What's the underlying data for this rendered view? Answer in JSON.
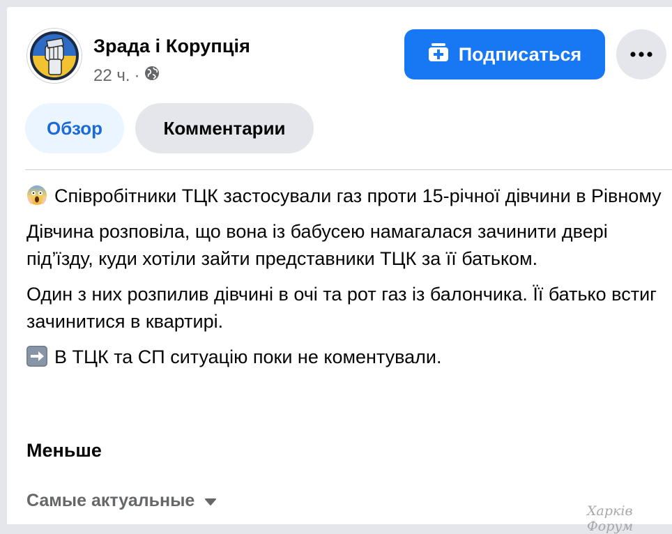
{
  "post": {
    "page_name": "Зрада і Корупція",
    "time": "22 ч.",
    "separator": "·",
    "subscribe_label": "Подписаться",
    "tabs": [
      {
        "label": "Обзор",
        "active": true
      },
      {
        "label": "Комментарии",
        "active": false
      }
    ],
    "paragraphs": [
      "Співробітники ТЦК застосували газ проти 15-річної дівчини в Рівному",
      "Дівчина розповіла, що вона із бабусею намагалася зачинити двері під’їзду, куди хотіли зайти представники ТЦК за її батьком.",
      "Один з них розпилив дівчині в очі та рот газ із балончика. Її батько встиг зачинитися в квартирі.",
      "В ТЦК та СП ситуацію поки не коментували."
    ],
    "less_label": "Меньше",
    "sort_label": "Самые актуальные"
  },
  "watermark": "Харків Форум",
  "icons": {
    "avatar": "fist-avatar-icon",
    "visibility": "globe-icon",
    "subscribe": "add-to-feed-icon",
    "more": "more-dots-icon",
    "first_paragraph": "screaming-face-emoji-icon",
    "last_paragraph": "right-arrow-emoji-icon",
    "sort": "caret-down-icon"
  },
  "colors": {
    "accent": "#1877f2",
    "tab_active_bg": "#ebf5ff",
    "tab_active_text": "#1b6ad8",
    "secondary_text": "#65676b",
    "button_gray": "#e4e6eb"
  }
}
